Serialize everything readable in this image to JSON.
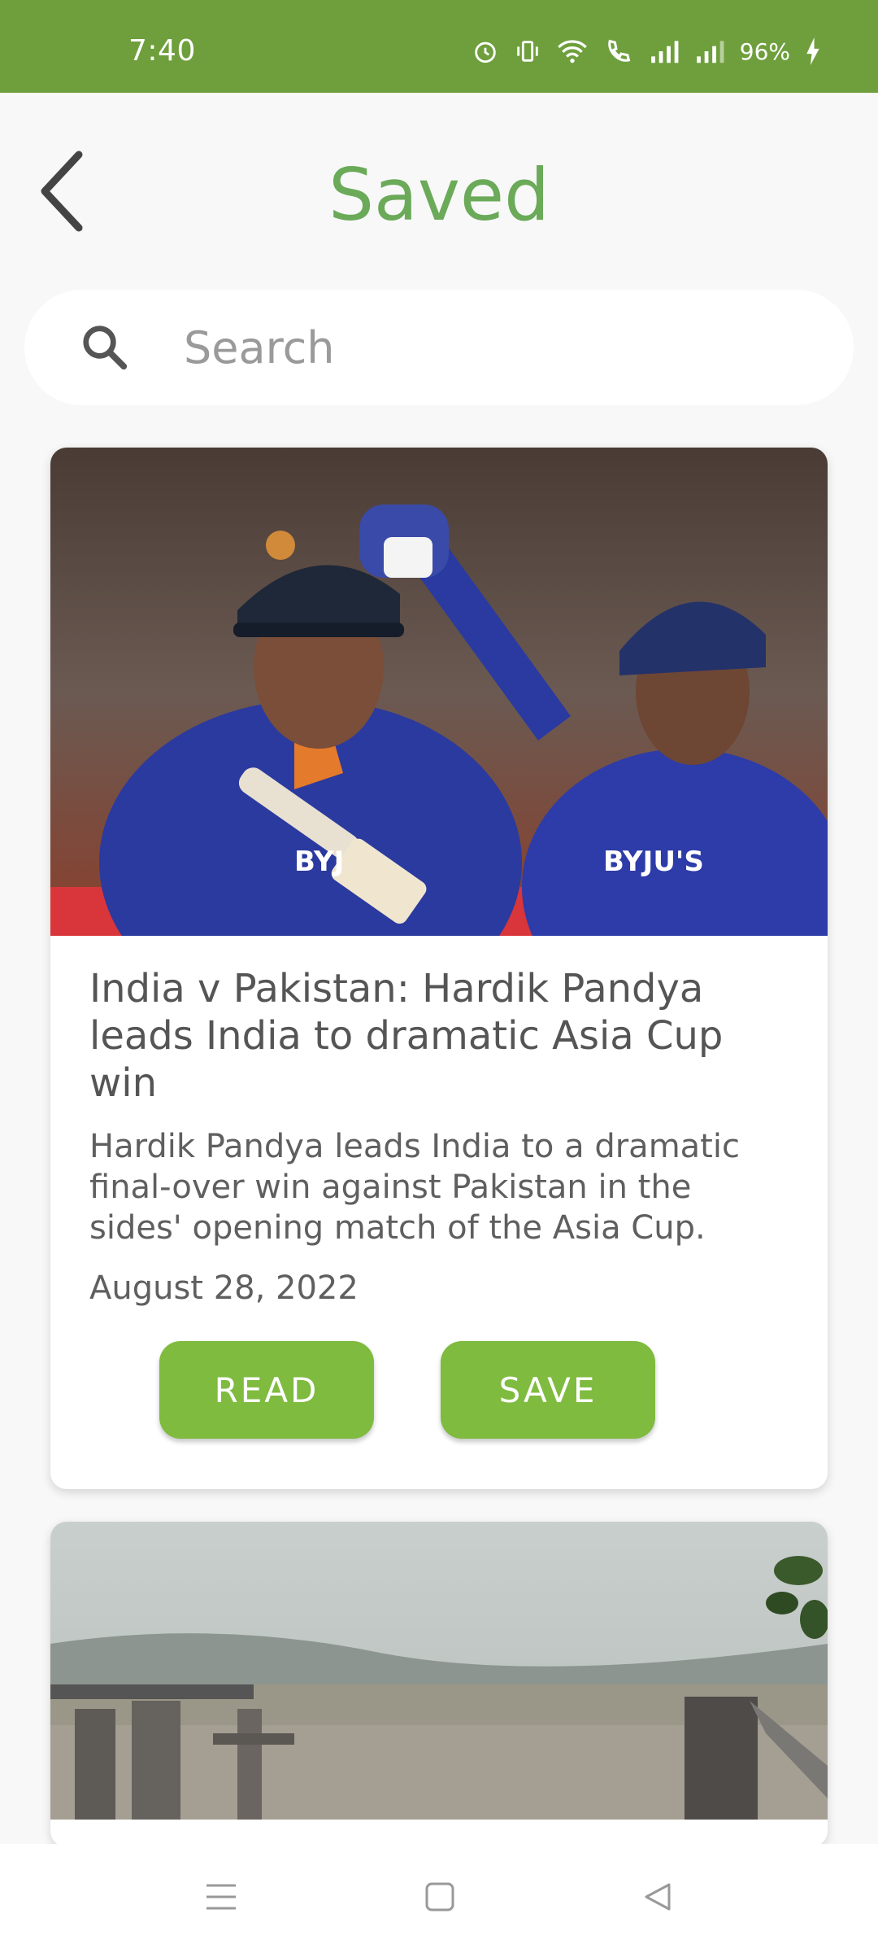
{
  "status_bar": {
    "time": "7:40",
    "battery": "96%"
  },
  "header": {
    "title": "Saved"
  },
  "search": {
    "placeholder": "Search"
  },
  "articles": [
    {
      "title": "India v Pakistan: Hardik Pandya leads India to dramatic Asia Cup win",
      "summary": "Hardik Pandya leads India to a dramatic final-over win against Pakistan in the sides' opening match of the Asia Cup.",
      "date": "August 28, 2022",
      "read_label": "READ",
      "save_label": "SAVE"
    }
  ],
  "colors": {
    "status_bar": "#6e9f3c",
    "title": "#6aaa58",
    "button": "#7fbb3f"
  },
  "icons": {
    "back": "chevron-left-icon",
    "search": "search-icon",
    "nav_menu": "menu-icon",
    "nav_home": "home-square-icon",
    "nav_back": "back-triangle-icon"
  }
}
